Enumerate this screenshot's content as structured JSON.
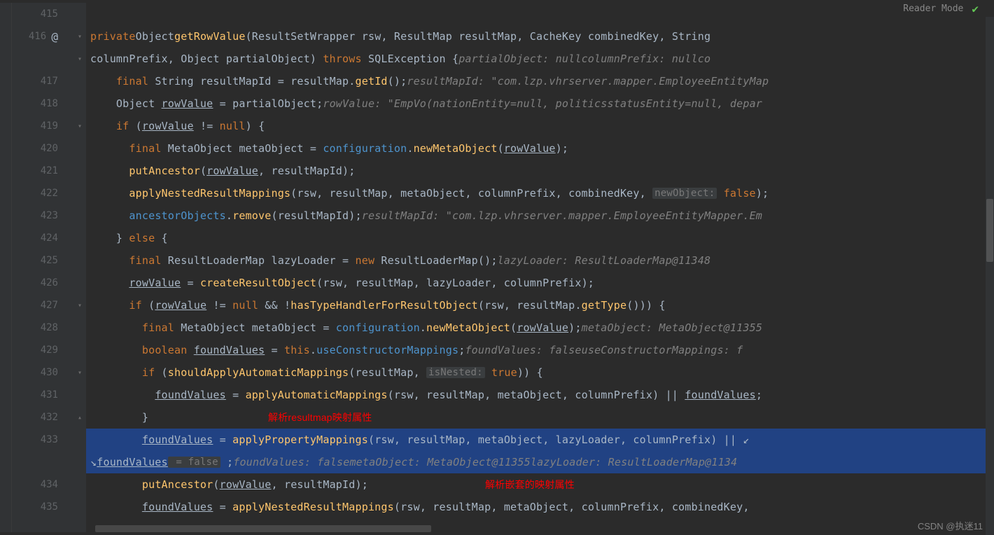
{
  "header": {
    "reader_mode": "Reader Mode"
  },
  "watermark": "CSDN @执迷11",
  "annotations": {
    "a1": "解析resultmap映射属性",
    "a2": "解析嵌套的映射属性"
  },
  "gutter": {
    "lines": [
      "415",
      "416",
      "",
      "417",
      "418",
      "419",
      "420",
      "421",
      "422",
      "423",
      "424",
      "425",
      "426",
      "427",
      "428",
      "429",
      "430",
      "431",
      "432",
      "433",
      "",
      "434",
      "435"
    ]
  },
  "code": {
    "at_sym": "@",
    "l416": {
      "kw_private": "private",
      "type_obj": "Object",
      "method": "getRowValue",
      "p_open": "(",
      "t_rsw": "ResultSetWrapper",
      "p_rsw": " rsw, ",
      "t_rm": "ResultMap",
      "p_rm": " resultMap, ",
      "t_ck": "CacheKey",
      "p_ck": " combinedKey, ",
      "t_str": "String"
    },
    "l416b": {
      "pre": "columnPrefix, ",
      "type_obj": "Object",
      "p_po": " partialObject) ",
      "kw_throws": "throws",
      "t_sqle": " SQLException ",
      "brace": "{",
      "c1": "partialObject: null",
      "c2": "columnPrefix: null",
      "c3": "co"
    },
    "l417": {
      "pre": "    ",
      "kw_final": "final",
      "t_str": " String ",
      "var": "resultMapId = resultMap.",
      "method": "getId",
      "post": "();",
      "comment": "resultMapId: \"com.lzp.vhrserver.mapper.EmployeeEntityMap"
    },
    "l418": {
      "pre": "    Object ",
      "uvar": "rowValue",
      "post": " = partialObject;",
      "comment": "rowValue: \"EmpVo(nationEntity=null, politicsstatusEntity=null, depar"
    },
    "l419": {
      "pre": "    ",
      "kw_if": "if",
      "open": " (",
      "uvar": "rowValue",
      "neq": " != ",
      "kw_null": "null",
      "close": ") {"
    },
    "l420": {
      "pre": "      ",
      "kw_final": "final",
      "t_mo": " MetaObject ",
      "var": "metaObject = ",
      "custom": "configuration",
      "dot": ".",
      "method": "newMetaObject",
      "open": "(",
      "uvar": "rowValue",
      "close": ");"
    },
    "l421": {
      "pre": "      ",
      "method": "putAncestor",
      "open": "(",
      "uvar": "rowValue",
      "post": ", resultMapId);"
    },
    "l422": {
      "pre": "      ",
      "method": "applyNestedResultMappings",
      "args": "(rsw, resultMap, metaObject, columnPrefix, combinedKey, ",
      "hint": "newObject:",
      "kw_false": " false",
      "close": ");"
    },
    "l423": {
      "pre": "      ",
      "custom": "ancestorObjects",
      "dot": ".",
      "method": "remove",
      "args": "(resultMapId);",
      "comment": "resultMapId: \"com.lzp.vhrserver.mapper.EmployeeEntityMapper.Em"
    },
    "l424": {
      "pre": "    } ",
      "kw_else": "else",
      "post": " {"
    },
    "l425": {
      "pre": "      ",
      "kw_final": "final",
      "t_rlm": " ResultLoaderMap ",
      "var": "lazyLoader = ",
      "kw_new": "new",
      "ctor": " ResultLoaderMap();",
      "comment": "lazyLoader: ResultLoaderMap@11348"
    },
    "l426": {
      "pre": "      ",
      "uvar": "rowValue",
      "eq": " = ",
      "method": "createResultObject",
      "args": "(rsw, resultMap, lazyLoader, columnPrefix);"
    },
    "l427": {
      "pre": "      ",
      "kw_if": "if",
      "open": " (",
      "uvar": "rowValue",
      "neq": " != ",
      "kw_null": "null",
      "and": " && !",
      "method": "hasTypeHandlerForResultObject",
      "args": "(rsw, resultMap.",
      "method2": "getType",
      "close": "())) {"
    },
    "l428": {
      "pre": "        ",
      "kw_final": "final",
      "t_mo": " MetaObject ",
      "var": "metaObject = ",
      "custom": "configuration",
      "dot": ".",
      "method": "newMetaObject",
      "open": "(",
      "uvar": "rowValue",
      "close": ");",
      "comment": "metaObject: MetaObject@11355"
    },
    "l429": {
      "pre": "        ",
      "kw_bool": "boolean",
      "sp": " ",
      "uvar": "foundValues",
      "eq": " = ",
      "kw_this": "this",
      "dot": ".",
      "custom": "useConstructorMappings",
      "semi": ";",
      "c1": "foundValues: false",
      "c2": "useConstructorMappings: f"
    },
    "l430": {
      "pre": "        ",
      "kw_if": "if",
      "open": " (",
      "method": "shouldApplyAutomaticMappings",
      "args": "(resultMap, ",
      "hint": "isNested:",
      "kw_true": " true",
      "close": ")) {"
    },
    "l431": {
      "pre": "          ",
      "uvar": "foundValues",
      "eq": " = ",
      "method": "applyAutomaticMappings",
      "args": "(rsw, resultMap, metaObject, columnPrefix) || ",
      "uvar2": "foundValues",
      "semi": ";"
    },
    "l432": {
      "pre": "        }"
    },
    "l433": {
      "pre": "        ",
      "uvar": "foundValues",
      "eq": " = ",
      "method": "applyPropertyMappings",
      "args": "(rsw, resultMap, metaObject, lazyLoader, columnPrefix) || ",
      "wrap": "↙"
    },
    "l433b": {
      "wrap": "↘",
      "uvar": "foundValues",
      "hint": " = false",
      "semi": " ;",
      "c1": "foundValues: false",
      "c2": "metaObject: MetaObject@11355",
      "c3": "lazyLoader: ResultLoaderMap@1134"
    },
    "l434": {
      "pre": "        ",
      "method": "putAncestor",
      "open": "(",
      "uvar": "rowValue",
      "post": ", resultMapId);"
    },
    "l435": {
      "pre": "        ",
      "uvar": "foundValues",
      "eq": " = ",
      "method": "applyNestedResultMappings",
      "args": "(rsw, resultMap, metaObject, columnPrefix, combinedKey,"
    }
  }
}
